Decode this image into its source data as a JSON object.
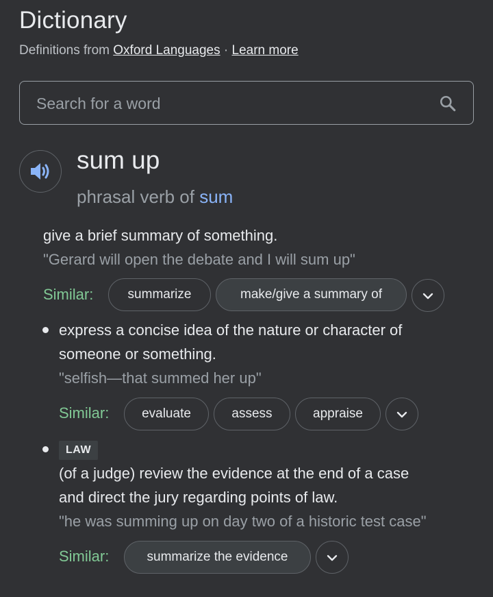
{
  "header": {
    "title": "Dictionary",
    "subtitle_prefix": "Definitions from ",
    "source_link": "Oxford Languages",
    "separator": " · ",
    "learn_more": "Learn more"
  },
  "search": {
    "placeholder": "Search for a word",
    "icon": "search-icon"
  },
  "entry": {
    "speaker_icon": "speaker-icon",
    "word": "sum up",
    "pos_prefix": "phrasal verb of ",
    "pos_link": "sum"
  },
  "senses": [
    {
      "definition": "give a brief summary of something.",
      "example": "\"Gerard will open the debate and I will sum up\"",
      "similar_label": "Similar:",
      "similar": [
        "summarize",
        "make/give a summary of"
      ]
    },
    {
      "definition_line1": "express a concise idea of the nature or character of",
      "definition_line2": "someone or something.",
      "example": "\"selfish—that summed her up\"",
      "similar_label": "Similar:",
      "similar": [
        "evaluate",
        "assess",
        "appraise"
      ]
    },
    {
      "tag": "LAW",
      "definition_line1": "(of a judge) review the evidence at the end of a case",
      "definition_line2": "and direct the jury regarding points of law.",
      "example": "\"he was summing up on day two of a historic test case\"",
      "similar_label": "Similar:",
      "similar": [
        "summarize the evidence"
      ]
    }
  ],
  "colors": {
    "background": "#303134",
    "text": "#e8eaed",
    "muted": "#9aa0a6",
    "link": "#8ab4f8",
    "similar_label": "#81c995",
    "speaker_icon": "#8ab4f8"
  }
}
